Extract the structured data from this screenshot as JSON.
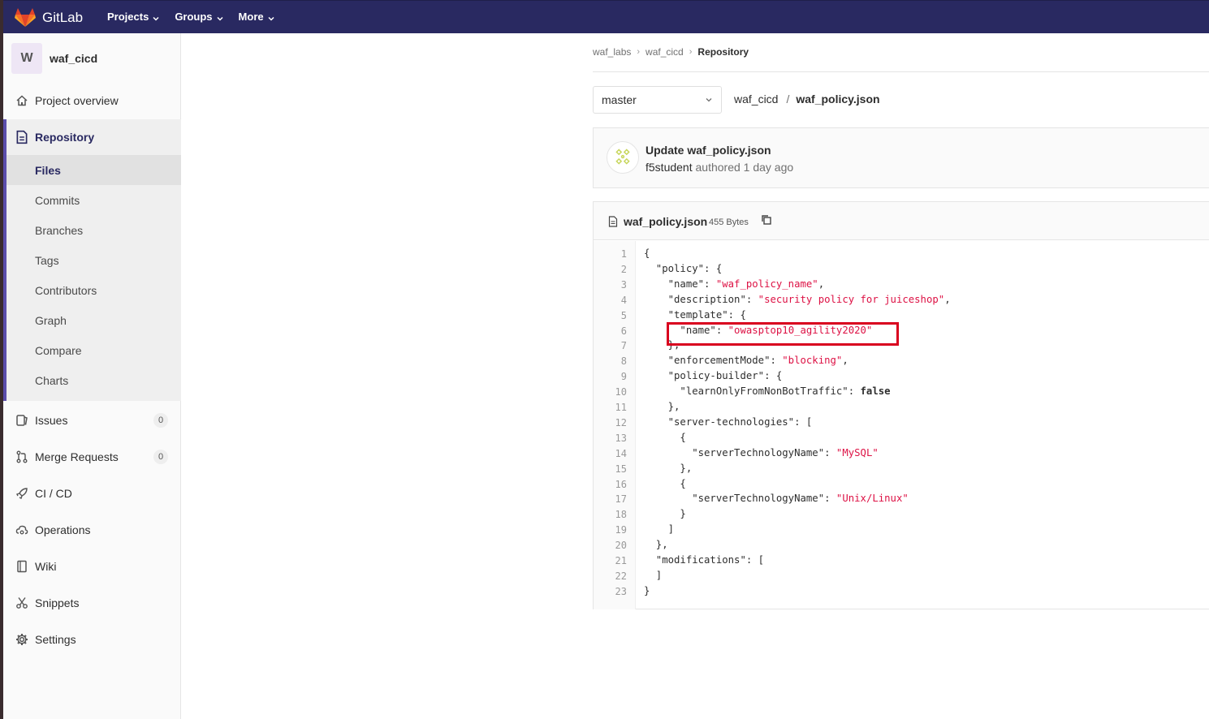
{
  "navbar": {
    "brand": "GitLab",
    "menu": [
      "Projects",
      "Groups",
      "More"
    ],
    "brand_color": "#292961"
  },
  "sidebar": {
    "project_avatar": "W",
    "project_name": "waf_cicd",
    "overview": "Project overview",
    "repository": {
      "label": "Repository",
      "items": [
        "Files",
        "Commits",
        "Branches",
        "Tags",
        "Contributors",
        "Graph",
        "Compare",
        "Charts"
      ]
    },
    "issues": {
      "label": "Issues",
      "count": "0"
    },
    "merge_requests": {
      "label": "Merge Requests",
      "count": "0"
    },
    "cicd": "CI / CD",
    "operations": "Operations",
    "wiki": "Wiki",
    "snippets": "Snippets",
    "settings": "Settings"
  },
  "breadcrumb": [
    "waf_labs",
    "waf_cicd",
    "Repository"
  ],
  "branch": "master",
  "path": {
    "repo": "waf_cicd",
    "file": "waf_policy.json"
  },
  "commit": {
    "title": "Update waf_policy.json",
    "author": "f5student",
    "meta": "authored 1 day ago"
  },
  "file": {
    "name": "waf_policy.json",
    "size": "455 Bytes",
    "line_numbers": [
      "1",
      "2",
      "3",
      "4",
      "5",
      "6",
      "7",
      "8",
      "9",
      "10",
      "11",
      "12",
      "13",
      "14",
      "15",
      "16",
      "17",
      "18",
      "19",
      "20",
      "21",
      "22",
      "23"
    ],
    "lines": [
      [
        [
          "p",
          "{"
        ]
      ],
      [
        [
          "p",
          "  \"policy\": {"
        ]
      ],
      [
        [
          "p",
          "    \"name\": "
        ],
        [
          "s",
          "\"waf_policy_name\""
        ],
        [
          "p",
          ","
        ]
      ],
      [
        [
          "p",
          "    \"description\": "
        ],
        [
          "s",
          "\"security policy for juiceshop\""
        ],
        [
          "p",
          ","
        ]
      ],
      [
        [
          "p",
          "    \"template\": {"
        ]
      ],
      [
        [
          "p",
          "      \"name\": "
        ],
        [
          "s",
          "\"owasptop10_agility2020\""
        ]
      ],
      [
        [
          "p",
          "    },"
        ]
      ],
      [
        [
          "p",
          "    \"enforcementMode\": "
        ],
        [
          "s",
          "\"blocking\""
        ],
        [
          "p",
          ","
        ]
      ],
      [
        [
          "p",
          "    \"policy-builder\": {"
        ]
      ],
      [
        [
          "p",
          "      \"learnOnlyFromNonBotTraffic\": "
        ],
        [
          "k",
          "false"
        ]
      ],
      [
        [
          "p",
          "    },"
        ]
      ],
      [
        [
          "p",
          "    \"server-technologies\": ["
        ]
      ],
      [
        [
          "p",
          "      {"
        ]
      ],
      [
        [
          "p",
          "        \"serverTechnologyName\": "
        ],
        [
          "s",
          "\"MySQL\""
        ]
      ],
      [
        [
          "p",
          "      },"
        ]
      ],
      [
        [
          "p",
          "      {"
        ]
      ],
      [
        [
          "p",
          "        \"serverTechnologyName\": "
        ],
        [
          "s",
          "\"Unix/Linux\""
        ]
      ],
      [
        [
          "p",
          "      }"
        ]
      ],
      [
        [
          "p",
          "    ]"
        ]
      ],
      [
        [
          "p",
          "  },"
        ]
      ],
      [
        [
          "p",
          "  \"modifications\": ["
        ]
      ],
      [
        [
          "p",
          "  ]"
        ]
      ],
      [
        [
          "p",
          "}"
        ]
      ]
    ]
  },
  "colors": {
    "highlight": "#d9001e",
    "string": "#dd1144",
    "active_border": "#5b4dab"
  }
}
